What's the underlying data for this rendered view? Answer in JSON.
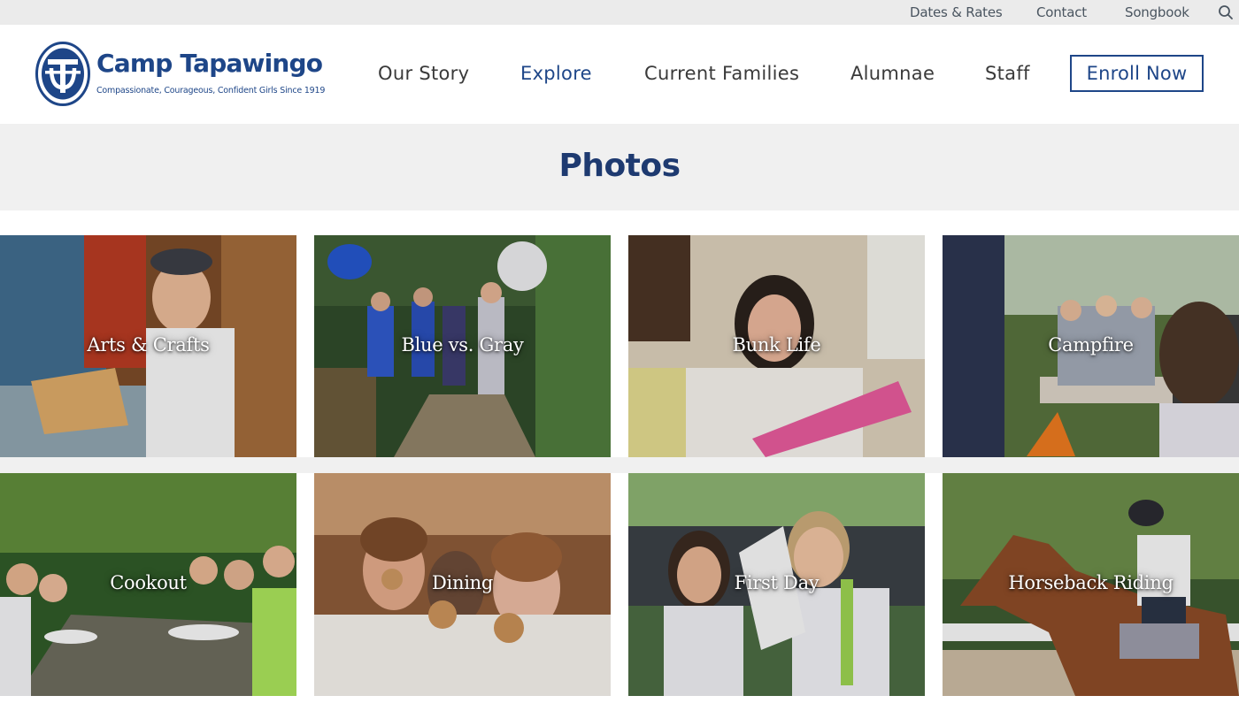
{
  "utility_nav": {
    "dates_rates": "Dates & Rates",
    "contact": "Contact",
    "songbook": "Songbook"
  },
  "logo": {
    "title": "Camp Tapawingo",
    "tagline": "Compassionate, Courageous, Confident Girls Since 1919"
  },
  "main_nav": {
    "items": [
      {
        "label": "Our Story"
      },
      {
        "label": "Explore",
        "active": true
      },
      {
        "label": "Current Families"
      },
      {
        "label": "Alumnae"
      },
      {
        "label": "Staff"
      }
    ],
    "enroll": "Enroll Now"
  },
  "page": {
    "title": "Photos"
  },
  "gallery": {
    "tiles": [
      {
        "label": "Arts & Crafts"
      },
      {
        "label": "Blue vs. Gray"
      },
      {
        "label": "Bunk Life"
      },
      {
        "label": "Campfire"
      },
      {
        "label": "Cookout"
      },
      {
        "label": "Dining"
      },
      {
        "label": "First Day"
      },
      {
        "label": "Horseback Riding"
      }
    ]
  },
  "colors": {
    "brand_blue": "#1e4688",
    "title_blue": "#1e3a70",
    "utility_bg": "#ebebeb",
    "band_bg": "#f0f0f0"
  },
  "icons": {
    "search": "search-icon",
    "logo_mark": "ct-monogram-icon"
  }
}
